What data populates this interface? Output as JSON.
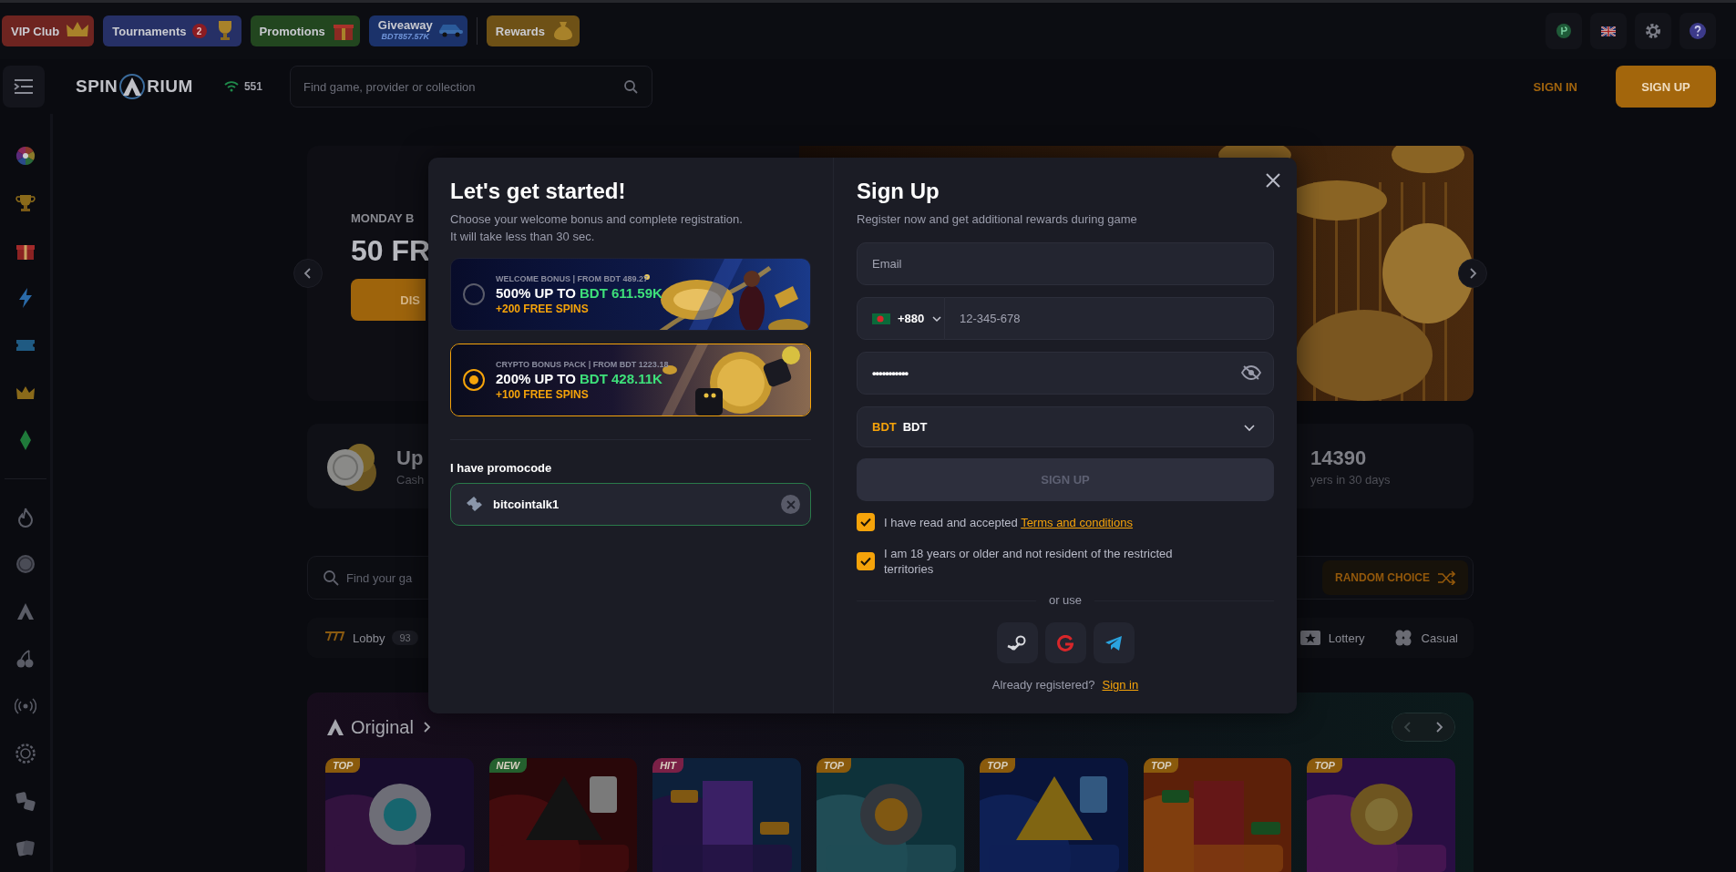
{
  "promo_bar": {
    "items": [
      {
        "label": "VIP Club",
        "kind": "crown",
        "color": "#6e2420"
      },
      {
        "label": "Tournaments",
        "badge": "2",
        "kind": "trophy",
        "color": "#263066"
      },
      {
        "label": "Promotions",
        "kind": "gift",
        "color": "#22461f"
      },
      {
        "label": "Giveaway",
        "sublabel": "BDT857.57K",
        "kind": "car",
        "color": "#1b326a"
      },
      {
        "label": "Rewards",
        "kind": "bag",
        "color": "#6e5116"
      }
    ]
  },
  "header": {
    "logo_left": "SPIN",
    "logo_right": "RIUM",
    "online_count": "551",
    "search": {
      "placeholder": "Find game, provider or collection"
    },
    "sign_in": "SIGN IN",
    "sign_up": "SIGN UP"
  },
  "banner": {
    "eyebrow": "MONDAY B",
    "title": "50 FR",
    "button": "DIS"
  },
  "stats": [
    {
      "kind": "coins",
      "title": "Up",
      "caption": "Cash"
    },
    {
      "kind": "counter",
      "title": "14390",
      "caption": "yers in 30 days"
    }
  ],
  "game_search": {
    "placeholder": "Find your ga",
    "random_button": "RANDOM CHOICE"
  },
  "categories": [
    {
      "kind": "lobby",
      "label": "Lobby",
      "count": "93"
    },
    {
      "kind": "lottery",
      "label": "Lottery"
    },
    {
      "kind": "casual",
      "label": "Casual"
    }
  ],
  "original": {
    "title": "Original",
    "games": [
      {
        "tag": "TOP",
        "color": "#8a5a0c"
      },
      {
        "tag": "NEW",
        "color": "#24602e"
      },
      {
        "tag": "HIT",
        "color": "#7a2046"
      },
      {
        "tag": "TOP",
        "color": "#8a5a0c"
      },
      {
        "tag": "TOP",
        "color": "#8a5a0c"
      },
      {
        "tag": "TOP",
        "color": "#8a5a0c"
      },
      {
        "tag": "TOP",
        "color": "#8a5a0c"
      }
    ]
  },
  "signup_modal": {
    "bonus_panel": {
      "title": "Let's get started!",
      "subtitle": [
        "Choose your welcome bonus and complete registration.",
        "It will take less than 30 sec."
      ],
      "bonuses": [
        {
          "kind": "welcome",
          "eyebrow": "WELCOME BONUS | FROM BDT 489.27",
          "headline": "500% UP TO",
          "amount": "BDT 611.59K",
          "spins": "+200 FREE SPINS",
          "selected": false
        },
        {
          "kind": "crypto",
          "eyebrow": "CRYPTO BONUS PACK | FROM BDT 1223.18",
          "headline": "200% UP TO",
          "amount": "BDT 428.11K",
          "spins": "+100 FREE SPINS",
          "selected": true
        }
      ],
      "promo_label": "I have promocode",
      "promo_code": {
        "value": "bitcointalk1",
        "valid": true
      }
    },
    "form": {
      "title": "Sign Up",
      "subtitle": "Register now and get additional rewards during game",
      "email": {
        "placeholder": "Email"
      },
      "phone": {
        "country_code": "+880",
        "placeholder": "12-345-678"
      },
      "password": {
        "value": "•••••••••••"
      },
      "currency": {
        "code": "BDT",
        "name": "BDT"
      },
      "submit": {
        "label": "SIGN UP",
        "disabled": true
      },
      "agreements": [
        {
          "text": "I have read and accepted",
          "link": "Terms and conditions",
          "checked": true
        },
        {
          "text": "I am 18 years or older and not resident of the restricted territories",
          "checked": true
        }
      ],
      "divider_text": "or use",
      "footer_text": "Already registered?",
      "footer_link": "Sign in"
    }
  }
}
